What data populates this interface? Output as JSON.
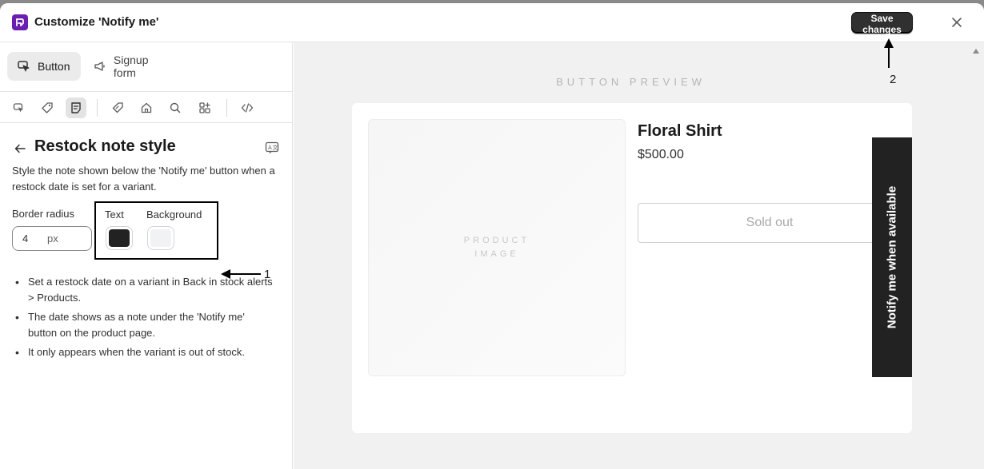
{
  "header": {
    "title": "Customize 'Notify me'",
    "save_label": "Save changes"
  },
  "sidebar": {
    "tabs": [
      {
        "label": "Button",
        "icon": "cursor-click-icon",
        "active": true
      },
      {
        "label": "Signup form",
        "icon": "megaphone-icon",
        "active": false
      }
    ],
    "toolbar_icons": [
      "cursor-click-icon",
      "tag-icon",
      "note-icon",
      "label-tag-icon",
      "home-icon",
      "search-icon",
      "apps-icon",
      "code-icon"
    ],
    "section": {
      "title": "Restock note style",
      "description": "Style the note shown below the 'Notify me' button when a restock date is set for a variant.",
      "border_radius": {
        "label": "Border radius",
        "value": "4",
        "unit": "px"
      },
      "colors": {
        "text_label": "Text",
        "text_color": "#222222",
        "background_label": "Background",
        "background_color": "#f1f2f4"
      },
      "bullets": [
        "Set a restock date on a variant in Back in stock alerts > Products.",
        "The date shows as a note under the 'Notify me' button on the product page.",
        "It only appears when the variant is out of stock."
      ]
    }
  },
  "preview": {
    "label": "BUTTON PREVIEW",
    "product_image_label": "PRODUCT IMAGE",
    "product_name": "Floral Shirt",
    "price": "$500.00",
    "sold_out_label": "Sold out",
    "notify_label": "Notify me when available"
  },
  "annotations": {
    "one": "1",
    "two": "2"
  },
  "colors": {
    "brand": "#6b1fb1",
    "primary_button": "#303030",
    "notify_tab": "#222222"
  }
}
